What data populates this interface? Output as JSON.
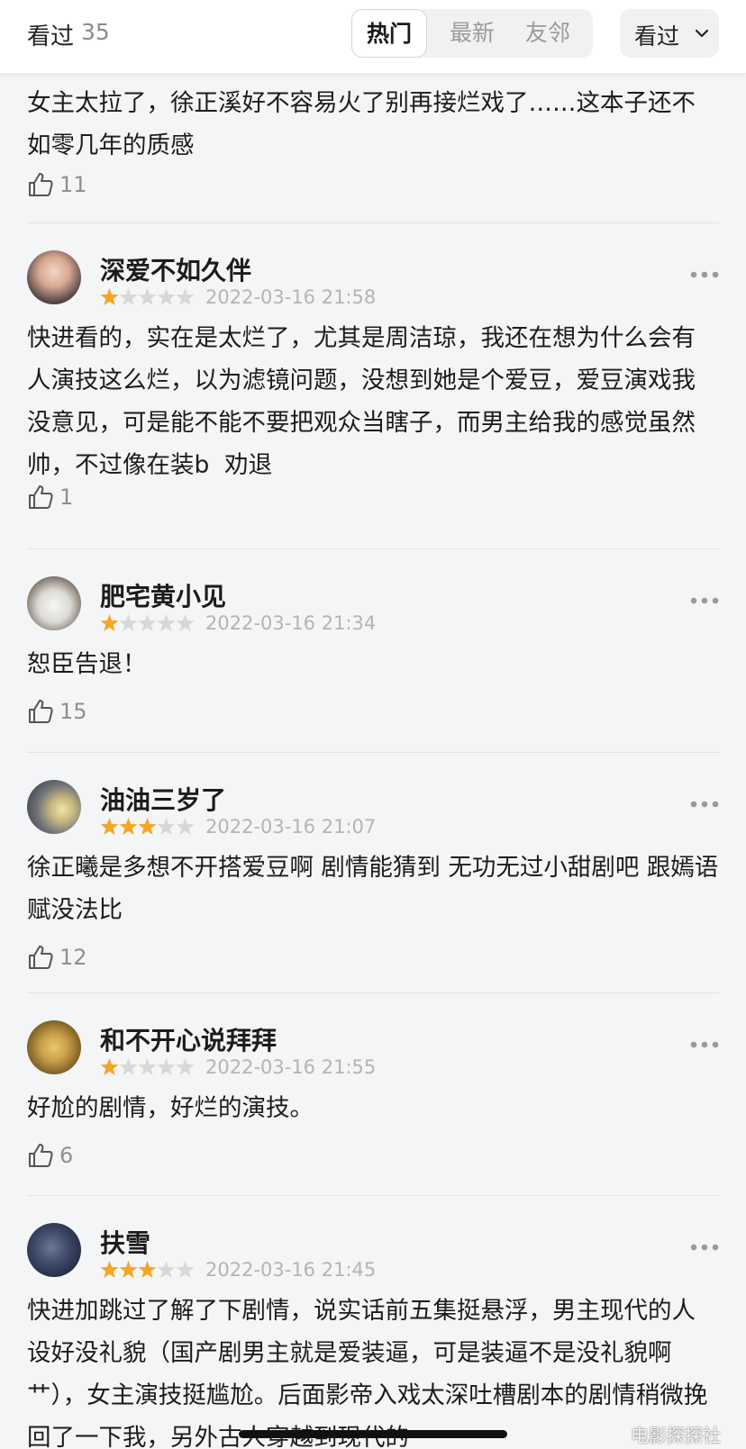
{
  "header": {
    "title": "看过",
    "count": "35",
    "tabs": [
      {
        "label": "热门",
        "active": true
      },
      {
        "label": "最新",
        "active": false
      },
      {
        "label": "友邻",
        "active": false
      }
    ],
    "filter_label": "看过",
    "filter_icon": "chevron-down-icon"
  },
  "colors": {
    "star_filled": "#f5a623",
    "star_empty": "#d8d8d8",
    "page_bg": "#f4f5f7"
  },
  "comments": [
    {
      "text": "女主太拉了，徐正溪好不容易火了别再接烂戏了……这本子还不如零几年的质感",
      "likes": "11"
    },
    {
      "username": "深爱不如久伴",
      "rating": 1,
      "date": "2022-03-16 21:58",
      "text": "快进看的，实在是太烂了，尤其是周洁琼，我还在想为什么会有人演技这么烂，以为滤镜问题，没想到她是个爱豆，爱豆演戏我没意见，可是能不能不要把观众当瞎子，而男主给我的感觉虽然帅，不过像在装b  劝退",
      "likes": "1"
    },
    {
      "username": "肥宅黄小见",
      "rating": 1,
      "date": "2022-03-16 21:34",
      "text": "恕臣告退！",
      "likes": "15"
    },
    {
      "username": "油油三岁了",
      "rating": 3,
      "date": "2022-03-16 21:07",
      "text": "徐正曦是多想不开搭爱豆啊 剧情能猜到 无功无过小甜剧吧 跟嫣语赋没法比",
      "likes": "12"
    },
    {
      "username": "和不开心说拜拜",
      "rating": 1,
      "date": "2022-03-16 21:55",
      "text": "好尬的剧情，好烂的演技。",
      "likes": "6"
    },
    {
      "username": "扶雪",
      "rating": 3,
      "date": "2022-03-16 21:45",
      "text": "快进加跳过了解了下剧情，说实话前五集挺悬浮，男主现代的人设好没礼貌（国产剧男主就是爱装逼，可是装逼不是没礼貌啊艹），女主演技挺尴尬。后面影帝入戏太深吐槽剧本的剧情稍微挽回了一下我，另外古人穿越到现代的"
    }
  ],
  "watermark": "电影探探社"
}
